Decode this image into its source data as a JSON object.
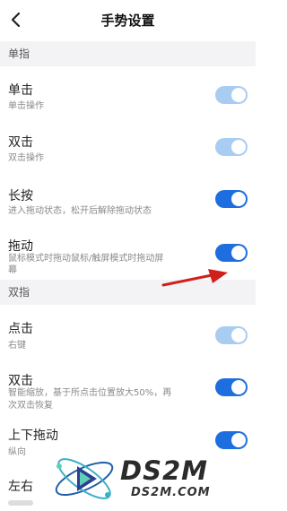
{
  "header": {
    "title": "手势设置",
    "back_icon": "chevron-left-icon"
  },
  "sections": {
    "single": "单指",
    "double": "双指"
  },
  "rows": {
    "tap": {
      "title": "单击",
      "sub": "单击操作"
    },
    "double_tap": {
      "title": "双击",
      "sub": "双击操作"
    },
    "long_press": {
      "title": "长按",
      "sub": "进入拖动状态，松开后解除拖动状态"
    },
    "drag": {
      "title": "拖动",
      "sub1": "鼠标模式时拖动鼠标/触屏模式时拖动屏",
      "sub2": "幕"
    },
    "two_tap": {
      "title": "点击",
      "sub": "右键"
    },
    "two_double": {
      "title": "双击",
      "sub1": "智能缩放，基于所点击位置放大50%，再",
      "sub2": "次双击恢复"
    },
    "two_drag": {
      "title": "上下拖动",
      "sub": "纵向"
    },
    "two_lr": {
      "title": "左右"
    }
  },
  "toggles": {
    "tap": "on-disabled",
    "double_tap": "on-disabled",
    "long_press": "on",
    "drag": "on",
    "two_tap": "on-disabled",
    "two_double": "on",
    "two_drag": "on"
  },
  "colors": {
    "accent": "#1e6ee0",
    "accent_disabled": "#a9cdf2",
    "section_bg": "#f3f3f5",
    "annotation_arrow": "#d0201b"
  },
  "watermark": {
    "big": "DS2M",
    "small": "DS2M.COM"
  }
}
